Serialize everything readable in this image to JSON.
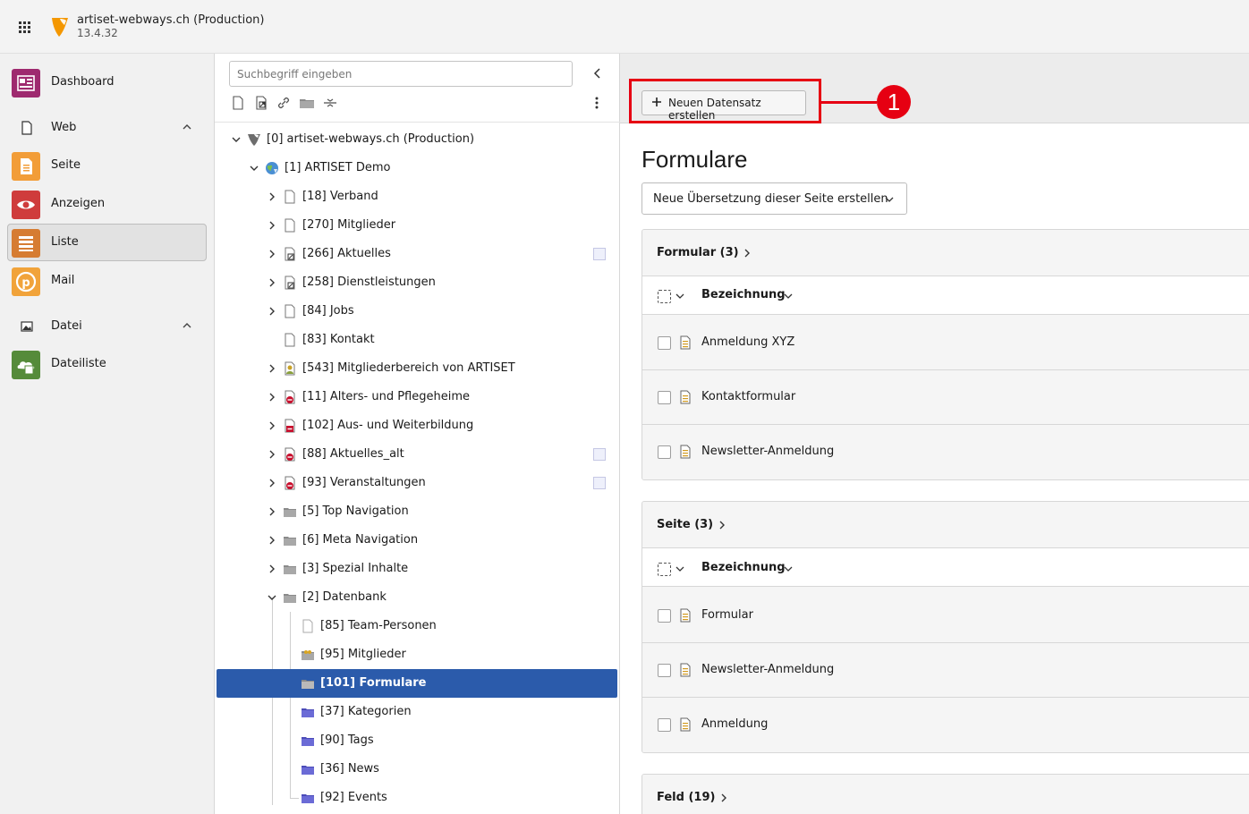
{
  "topbar": {
    "site_name": "artiset-webways.ch (Production)",
    "version": "13.4.32"
  },
  "modules": {
    "dashboard": "Dashboard",
    "web": "Web",
    "seite": "Seite",
    "anzeigen": "Anzeigen",
    "liste": "Liste",
    "mail": "Mail",
    "datei": "Datei",
    "dateiliste": "Dateiliste"
  },
  "tree": {
    "search_placeholder": "Suchbegriff eingeben",
    "nodes": [
      {
        "label": "[0] artiset-webways.ch (Production)",
        "icon": "typo3-root-icon"
      },
      {
        "label": "[1] ARTISET Demo",
        "icon": "globe-site-icon"
      },
      {
        "label": "[18] Verband",
        "icon": "page-icon"
      },
      {
        "label": "[270] Mitglieder",
        "icon": "page-icon"
      },
      {
        "label": "[266] Aktuelles",
        "icon": "page-shortcut-icon"
      },
      {
        "label": "[258] Dienstleistungen",
        "icon": "page-shortcut-icon"
      },
      {
        "label": "[84] Jobs",
        "icon": "page-icon"
      },
      {
        "label": "[83] Kontakt",
        "icon": "page-icon"
      },
      {
        "label": "[543] Mitgliederbereich von ARTISET",
        "icon": "page-user-icon"
      },
      {
        "label": "[11] Alters- und Pflegeheime",
        "icon": "page-hidden-icon"
      },
      {
        "label": "[102] Aus- und Weiterbildung",
        "icon": "page-hidden-icon"
      },
      {
        "label": "[88] Aktuelles_alt",
        "icon": "page-hidden-icon"
      },
      {
        "label": "[93] Veranstaltungen",
        "icon": "page-hidden-icon"
      },
      {
        "label": "[5] Top Navigation",
        "icon": "folder-icon"
      },
      {
        "label": "[6] Meta Navigation",
        "icon": "folder-icon"
      },
      {
        "label": "[3] Spezial Inhalte",
        "icon": "folder-icon"
      },
      {
        "label": "[2] Datenbank",
        "icon": "folder-icon"
      },
      {
        "label": "[85] Team-Personen",
        "icon": "page-icon"
      },
      {
        "label": "[95] Mitglieder",
        "icon": "folder-users-icon"
      },
      {
        "label": "[101] Formulare",
        "icon": "folder-icon"
      },
      {
        "label": "[37] Kategorien",
        "icon": "folder-blue-icon"
      },
      {
        "label": "[90] Tags",
        "icon": "folder-blue-icon"
      },
      {
        "label": "[36] News",
        "icon": "folder-blue-icon"
      },
      {
        "label": "[92] Events",
        "icon": "folder-blue-icon"
      }
    ]
  },
  "main": {
    "new_record_label": "Neuen Datensatz erstellen",
    "callout_number": "1",
    "page_title": "Formulare",
    "translation_select": "Neue Übersetzung dieser Seite erstellen",
    "panels": [
      {
        "title": "Formular (3)",
        "column": "Bezeichnung",
        "rows": [
          "Anmeldung XYZ",
          "Kontaktformular",
          "Newsletter-Anmeldung"
        ]
      },
      {
        "title": "Seite (3)",
        "column": "Bezeichnung",
        "rows": [
          "Formular",
          "Newsletter-Anmeldung",
          "Anmeldung"
        ]
      },
      {
        "title": "Feld (19)"
      }
    ]
  },
  "colors": {
    "selected_node": "#2b5bab",
    "callout": "#e60012",
    "dashboard_icon": "#9e2a6f",
    "seite_icon": "#f29d38",
    "anzeigen_icon": "#cf3c3c",
    "liste_icon": "#d67c32",
    "mail_icon": "#f1a33a",
    "dateiliste_icon": "#558b3a"
  }
}
